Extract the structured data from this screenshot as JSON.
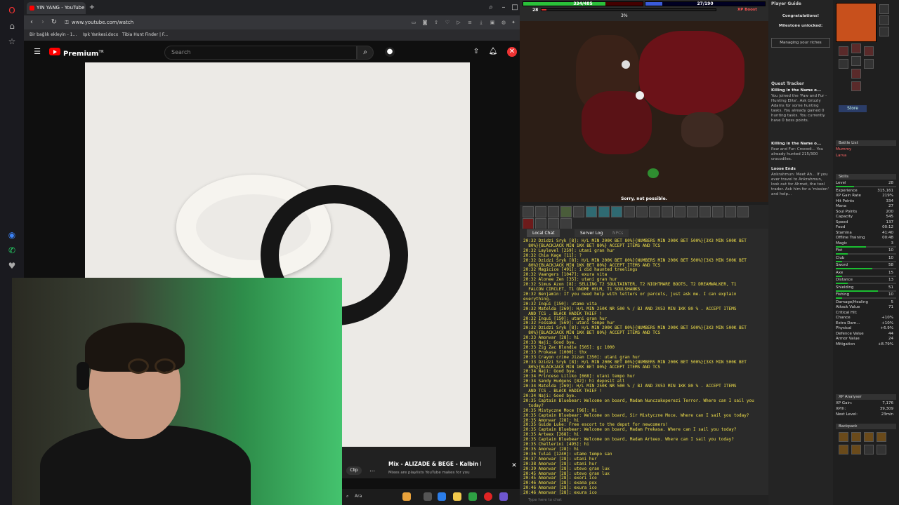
{
  "browser": {
    "tab_title": "YIN YANG - YouTube",
    "url": "www.youtube.com/watch",
    "bookmarks": [
      "Bir bağlık ekleyin - 1...",
      "Işık Yankesi.docx",
      "Tibia Hunt Finder | F..."
    ]
  },
  "youtube": {
    "logo": "Premium",
    "logo_sup": "TR",
    "search_placeholder": "Search",
    "mix_title": "Mix - ALIZADE & BEGE - Kalbin ban...",
    "mix_sub": "Mixes are playlists YouTube makes for you",
    "clip_label": "Clip"
  },
  "taskbar": {
    "search": "Ara"
  },
  "game": {
    "health": "334/485",
    "mana": "27/190",
    "level": "28",
    "xp_percent": "3%",
    "xp_boost": "XP Boost",
    "health_fraction": 0.69,
    "mana_fraction": 0.14,
    "sorry": "Sorry, not possible.",
    "chat_tabs": [
      "Local Chat",
      "Server Log",
      "NPCs"
    ],
    "chat_input_placeholder": "Type here to chat",
    "chat": [
      "20:32 Dzidzi Sryk [8]: H/L MIN 200K BET 80%}{NUMBERS MIN 200K BET 500%}{3X3 MIN 500K BET",
      "  80%}{BLACKJACK MIN 1KK BET 80%} ACCEPT ITEMS AND TCS",
      "20:32 Laylevel [259]: utani gran hur",
      "20:32 Chia Kage [11]: ?",
      "20:32 Dzidzi Sryk [8]: H/L MIN 200K BET 80%}{NUMBERS MIN 200K BET 500%}{3X3 MIN 500K BET",
      "  80%}{BLACKJACK MIN 1KK BET 80%} ACCEPT ITEMS AND TCS",
      "20:32 Magicice [491]: i did haunted treelings",
      "20:32 Vaangers [1047]: exura vita",
      "20:32 Alonee Zen [35]: utani gran hur",
      "20:32 Simus Azon [8]: SELLING T2 SOULTAINTER, T2 NIGHTMARE BOOTS, T2 DREAMWALKER, T1",
      "  FALCON CIRCLET, T1 GNOME HELM, T1 SOULSHANKS",
      "20:32 Benjamin: If you need help with letters or parcels, just ask me. I can explain everything.",
      "20:32 Inqui [150]: utamo vita",
      "20:32 Matelda [269]: H/L MIN 250K NR 500 % / BJ AND 3V53 MIN 1KK 80 % . ACCEPT ITEMS",
      "  AND TCS . BLACK HADIK THIEF !",
      "20:32 Inqui [150]: utani gran hur",
      "20:32 Fossake [569]: utani tempo hur",
      "20:32 Dzidzi Sryk [8]: H/L MIN 200K BET 80%}{NUMBERS MIN 200K BET 500%}{3X3 MIN 500K BET",
      "  80%}{BLACKJACK MIN 1KK BET 80%} ACCEPT ITEMS AND TCS",
      "20:33 Amonvar [28]: hi",
      "20:33 Naji: Good bye.",
      "20:33 Zig Zac Blondie [505]: gz 1000",
      "20:33 Prokasa [1000]: thx",
      "20:33 Crayon crime Jizan [350]: utani gran hur",
      "20:33 Dzidzi Sryk [8]: H/L MIN 200K BET 80%}{NUMBERS MIN 200K BET 500%}{3X3 MIN 500K BET",
      "  80%}{BLACKJACK MIN 1KK BET 80%} ACCEPT ITEMS AND TCS",
      "20:34 Naji: Good bye.",
      "20:34 Princeso Liliko [668]: utani tempo hur",
      "20:34 Sandy Hudgens [82]: hi deposit all",
      "20:34 Matelda [269]: H/L MIN 250K NR 500 % / BJ AND 3V53 MIN 1KK 80 % . ACCEPT ITEMS",
      "  AND TCS . BLACK HADIK THIEF !",
      "20:34 Naji: Good bye.",
      "20:35 Captain Bluebear: Welcome on board, Madam Nunczakoperezi Terror. Where can I sail you",
      "  today?",
      "20:35 Mistyczne Moce [96]: Hi",
      "20:35 Captain Bluebear: Welcome on board, Sir Mistyczne Moce. Where can I sail you today?",
      "20:35 Amonvar [28]: hi",
      "20:35 Guide Luke: Free escort to the depot for newcomers!",
      "20:35 Captain Bluebear: Welcome on board, Madam Prekasa. Where can I sail you today?",
      "20:35 Arteex [268]: hi",
      "20:35 Captain Bluebear: Welcome on board, Madam Arteex. Where can I sail you today?",
      "20:35 Chellerini [495]: hi",
      "20:35 Amonvar [28]: hi",
      "20:36 Tulai [1240]: utamo tempo san",
      "20:37 Amonvar [28]: utani hur",
      "20:38 Amonvar [28]: utani hur",
      "20:39 Amonvar [28]: utevo gran lux",
      "20:45 Amonvar [28]: utevo gran lux",
      "20:45 Amonvar [28]: exori ico",
      "20:46 Amonvar [28]: exana pox",
      "20:46 Amonvar [28]: exura ico",
      "20:46 Amonvar [28]: exura ico",
      "20:46 Amonvar [28]: exori ico"
    ],
    "player_guide": {
      "title": "Player Guide",
      "congrats": "Congratulations!",
      "milestone": "Milestone unlocked:",
      "riches": "Managing your riches"
    },
    "quest_tracker": {
      "title": "Quest Tracker",
      "q1_title": "Killing in the Name o...",
      "q1_text": "You joined the 'Paw and Fur - Hunting Elite'. Ask Grizzly Adams for some hunting tasks. You already gained 0 hunting tasks. You currently have 0 boss points.",
      "q2_title": "Killing in the Name o...",
      "q2_text": "Paw and Fur: Crocodi... You already hunted 215/300 crocodiles.",
      "q3_title": "Loose Ends",
      "q3_text": "Ankrahmun: Meet Ah... If you ever travel to Ankrahmun, look out for Ahmet, the tool trader. Ask him for a 'mission' and help..."
    },
    "store": "Store",
    "battle_list": {
      "title": "Battle List",
      "entries": [
        "Mummy",
        "Larva"
      ]
    },
    "skills": {
      "title": "Skills",
      "rows": [
        {
          "label": "Level",
          "value": "28",
          "fraction": 0.3
        },
        {
          "label": "Experience",
          "value": "315,161",
          "fraction": 0
        },
        {
          "label": "XP Gain Rate",
          "value": "219%",
          "fraction": 0
        },
        {
          "label": "Hit Points",
          "value": "334",
          "fraction": 0
        },
        {
          "label": "Mana",
          "value": "27",
          "fraction": 0
        },
        {
          "label": "Soul Points",
          "value": "200",
          "fraction": 0
        },
        {
          "label": "Capacity",
          "value": "545",
          "fraction": 0
        },
        {
          "label": "Speed",
          "value": "137",
          "fraction": 0
        },
        {
          "label": "Food",
          "value": "00:12",
          "fraction": 0
        },
        {
          "label": "Stamina",
          "value": "41:40",
          "fraction": 0
        },
        {
          "label": "Offline Training",
          "value": "00:48",
          "fraction": 0
        },
        {
          "label": "Magic",
          "value": "3",
          "fraction": 0.5
        },
        {
          "label": "Fist",
          "value": "10",
          "fraction": 0.2
        },
        {
          "label": "Club",
          "value": "10",
          "fraction": 0.1
        },
        {
          "label": "Sword",
          "value": "58",
          "fraction": 0.6
        },
        {
          "label": "Axe",
          "value": "15",
          "fraction": 0.1
        },
        {
          "label": "Distance",
          "value": "13",
          "fraction": 0.2
        },
        {
          "label": "Shielding",
          "value": "51",
          "fraction": 0.7
        },
        {
          "label": "Fishing",
          "value": "10",
          "fraction": 0.1
        },
        {
          "label": "Damage/Healing",
          "value": "5",
          "fraction": 0
        },
        {
          "label": "Attack Value",
          "value": "71",
          "fraction": 0
        },
        {
          "label": "Critical Hit:",
          "value": "",
          "fraction": 0
        },
        {
          "label": "Chance",
          "value": "+10%",
          "fraction": 0
        },
        {
          "label": "Extra Dam...",
          "value": "+10%",
          "fraction": 0
        },
        {
          "label": "Physical",
          "value": "+6.9%",
          "fraction": 0
        },
        {
          "label": "Defence Value",
          "value": "44",
          "fraction": 0
        },
        {
          "label": "Armor Value",
          "value": "24",
          "fraction": 0
        },
        {
          "label": "Mitigation",
          "value": "+8.79%",
          "fraction": 0
        }
      ]
    },
    "xp_analyser": {
      "title": "XP Analyser",
      "rows": [
        {
          "label": "XP Gain:",
          "value": "7,176"
        },
        {
          "label": "XP/h:",
          "value": "39,309"
        },
        {
          "label": "Next Level:",
          "value": "23min"
        }
      ]
    },
    "backpack_title": "Backpack"
  }
}
